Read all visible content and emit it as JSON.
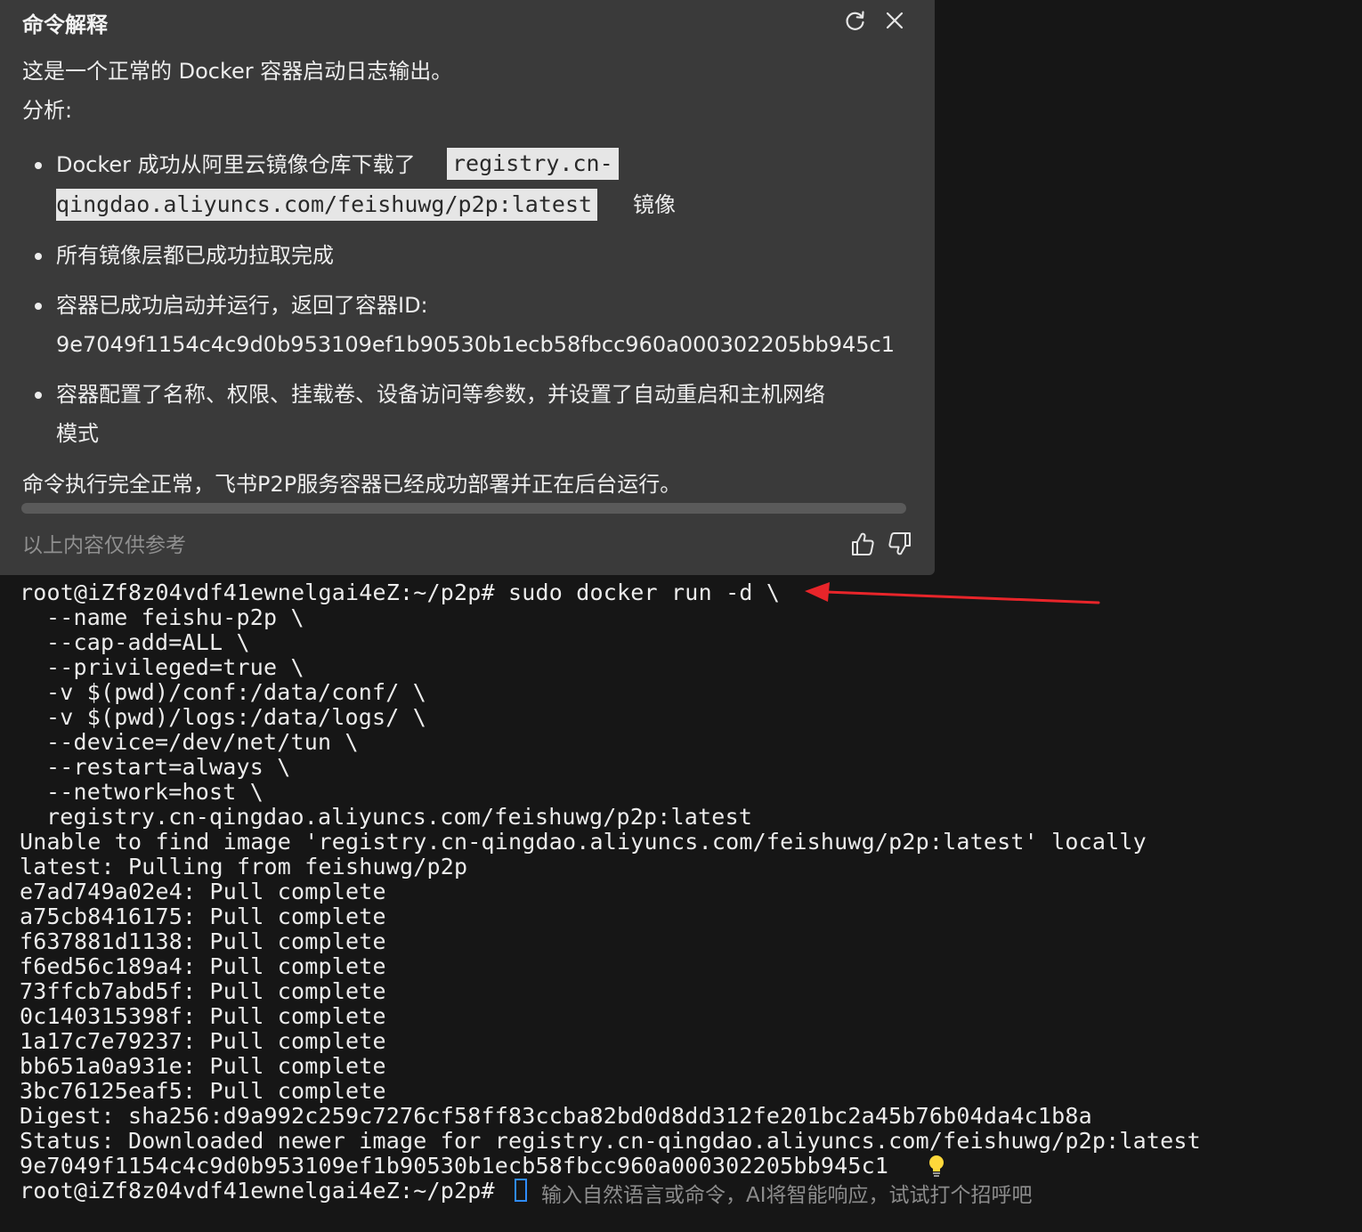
{
  "terminal": {
    "lines": [
      "root@iZf8z04vdf41ewnelgai4eZ:~/p2p# sudo docker run -d \\",
      "--name feishu-p2p \\",
      "--cap-add=ALL \\",
      "--privileged=true \\",
      "-v $(pwd)/conf:/data/conf/ \\",
      "-v $(pwd)/logs:/data/logs/ \\",
      "--device=/dev/net/tun \\",
      "--restart=always \\",
      "--network=host \\",
      "registry.cn-qingdao.aliyuncs.com/feishuwg/p2p:latest",
      "Unable to find image 'registry.cn-qingdao.aliyuncs.com/feishuwg/p2p:latest' locally",
      "latest: Pulling from feishuwg/p2p",
      "e7ad749a02e4: Pull complete",
      "a75cb8416175: Pull complete",
      "f637881d1138: Pull complete",
      "f6ed56c189a4: Pull complete",
      "73ffcb7abd5f: Pull complete",
      "0c140315398f: Pull complete",
      "1a17c7e79237: Pull complete",
      "bb651a0a931e: Pull complete",
      "3bc76125eaf5: Pull complete",
      "Digest: sha256:d9a992c259c7276cf58ff83ccba82bd0d8dd312fe201bc2a45b76b04da4c1b8a",
      "Status: Downloaded newer image for registry.cn-qingdao.aliyuncs.com/feishuwg/p2p:latest",
      "9e7049f1154c4c9d0b953109ef1b90530b1ecb58fbcc960a000302205bb945c1"
    ],
    "prompt": "root@iZf8z04vdf41ewnelgai4eZ:~/p2p# ",
    "input_placeholder": "输入自然语言或命令，AI将智能响应，试试打个招呼吧",
    "arrow_color": "#e8252a",
    "cursor_color": "#2f8cff"
  },
  "ai_panel": {
    "title": "命令解释",
    "refresh_icon": "refresh-icon",
    "close_icon": "close-icon",
    "intro": "这是一个正常的 Docker 容器启动日志输出。",
    "analysis_label": "分析:",
    "bullets": {
      "b1_prefix": "Docker 成功从阿里云镜像仓库下载了",
      "b1_code_part1": "registry.cn-",
      "b1_code_part2": "qingdao.aliyuncs.com/feishuwg/p2p:latest",
      "b1_suffix": "镜像",
      "b2": "所有镜像层都已成功拉取完成",
      "b3_line1": "容器已成功启动并运行，返回了容器ID:",
      "b3_line2": "9e7049f1154c4c9d0b953109ef1b90530b1ecb58fbcc960a000302205bb945c1",
      "b4_line1": "容器配置了名称、权限、挂载卷、设备访问等参数，并设置了自动重启和主机网络",
      "b4_line2": "模式"
    },
    "conclusion": "命令执行完全正常，飞书P2P服务容器已经成功部署并正在后台运行。",
    "disclaimer": "以上内容仅供参考",
    "thumbs_up_icon": "thumbs-up-icon",
    "thumbs_down_icon": "thumbs-down-icon",
    "background": "#3a3a3a"
  }
}
